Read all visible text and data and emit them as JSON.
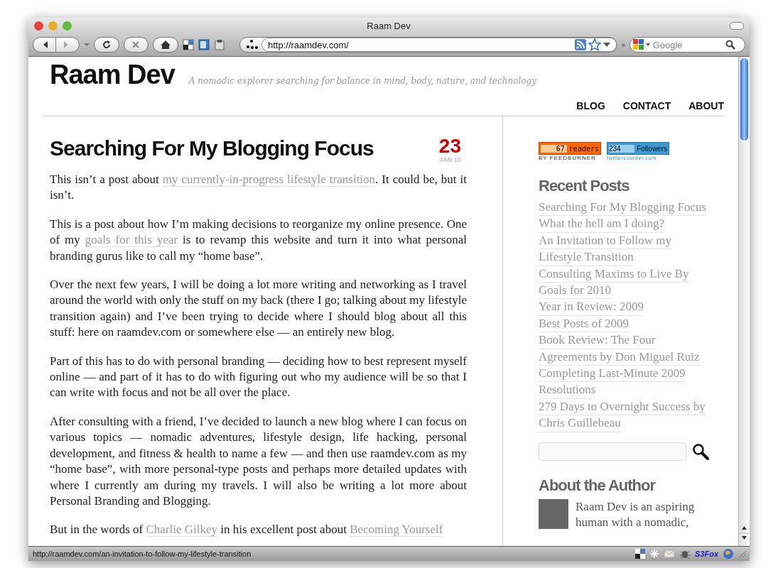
{
  "window": {
    "title": "Raam Dev"
  },
  "toolbar": {
    "url": "http://raamdev.com/",
    "search_placeholder": "Google"
  },
  "site": {
    "title": "Raam Dev",
    "tagline": "A nomadic explorer searching for balance in mind, body, nature, and technology",
    "nav": [
      "BLOG",
      "CONTACT",
      "ABOUT"
    ]
  },
  "post": {
    "title": "Searching For My Blogging Focus",
    "day": "23",
    "month": "JAN 10",
    "paragraphs": [
      [
        {
          "kind": "text",
          "text": "This isn’t a post about "
        },
        {
          "kind": "link",
          "text": "my currently-in-progress lifestyle transition"
        },
        {
          "kind": "text",
          "text": ". It could be, but it isn’t."
        }
      ],
      [
        {
          "kind": "text",
          "text": "This is a post about how I’m making decisions to reorganize my online presence. One of my "
        },
        {
          "kind": "link",
          "text": "goals for this year"
        },
        {
          "kind": "text",
          "text": " is to revamp this website and turn it into what personal branding gurus like to call my “home base”."
        }
      ],
      [
        {
          "kind": "text",
          "text": "Over the next few years, I will be doing a lot more writing and networking as I travel around the world with only the stuff on my back (there I go; talking about my lifestyle transition again) and I’ve been trying to decide where I should blog about all this stuff: here on raamdev.com or somewhere else — an entirely new blog."
        }
      ],
      [
        {
          "kind": "text",
          "text": "Part of this has to do with personal branding — deciding how to best represent myself online — and part of it has to do with figuring out who my audience will be so that I can write with focus and not be all over the place."
        }
      ],
      [
        {
          "kind": "text",
          "text": "After consulting with a friend, I’ve decided to launch a new blog where I can focus on various topics — nomadic adventures, lifestyle design, life hacking, personal development, and fitness & health to name a few — and then use raamdev.com as my “home base”, with more personal-type posts and perhaps more detailed updates with where I currently am during my travels. I will also be writing a lot more about Personal Branding and Blogging."
        }
      ],
      [
        {
          "kind": "text",
          "text": "But in the words of "
        },
        {
          "kind": "link",
          "text": "Charlie Gilkey"
        },
        {
          "kind": "text",
          "text": " in his excellent post about "
        },
        {
          "kind": "link",
          "text": "Becoming Yourself"
        }
      ]
    ]
  },
  "sidebar": {
    "feedburner": {
      "count": "67",
      "label": "readers",
      "byline": "BY FEEDBURNER"
    },
    "twitter": {
      "count": "234",
      "label": "Followers",
      "byline": "twittercounter.com"
    },
    "recent_title": "Recent Posts",
    "recent_posts": [
      [
        "Searching For My Blogging Focus"
      ],
      [
        "What the hell am I doing?"
      ],
      [
        "An Invitation to Follow my",
        "Lifestyle Transition"
      ],
      [
        "Consulting Maxims to Live By"
      ],
      [
        "Goals for 2010"
      ],
      [
        "Year in Review: 2009"
      ],
      [
        "Best Posts of 2009"
      ],
      [
        "Book Review: The Four",
        "Agreements by Don Miguel Ruiz"
      ],
      [
        "Completing Last-Minute 2009",
        "Resolutions"
      ],
      [
        "279 Days to Overnight Success by",
        "Chris Guillebeau"
      ]
    ],
    "about_title": "About the Author",
    "about_text": "Raam Dev is an aspiring human with a nomadic,"
  },
  "status_bar": {
    "url": "http://raamdev.com/an-invitation-to-follow-my-lifestyle-transition",
    "addon_label": "S3Fox"
  }
}
